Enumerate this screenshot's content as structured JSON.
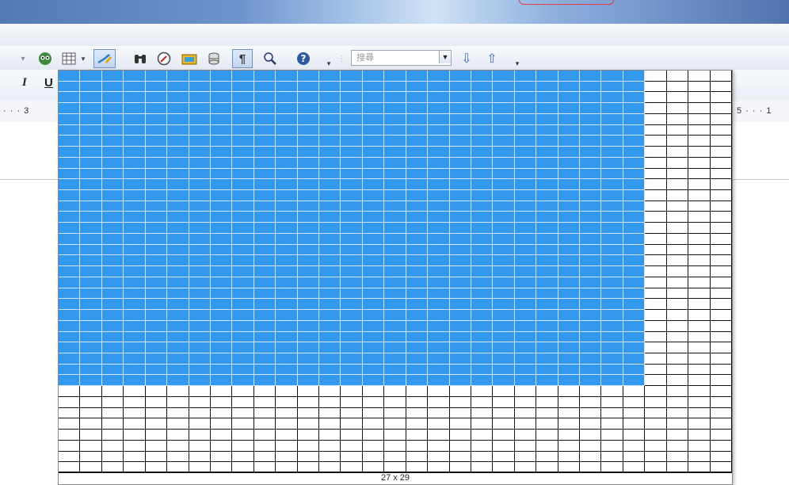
{
  "toolbar": {
    "search_placeholder": "搜尋",
    "items": [
      "chart-icon",
      "table-icon",
      "draw-icon",
      "find-icon",
      "navigator-icon",
      "gallery-icon",
      "datasource-icon",
      "formatting-marks-icon",
      "zoom-icon",
      "help-icon"
    ]
  },
  "formatting": {
    "italic": "I",
    "underline": "U"
  },
  "ruler": {
    "left_text": "· · · 3",
    "right_text": "5 · · · 1"
  },
  "table_picker": {
    "label": "27 x 29",
    "grid_columns": 31,
    "grid_rows": 37,
    "selected_columns": 27,
    "selected_rows": 29
  },
  "colors": {
    "selection": "#3399ee",
    "title_accent": "#e04040"
  }
}
